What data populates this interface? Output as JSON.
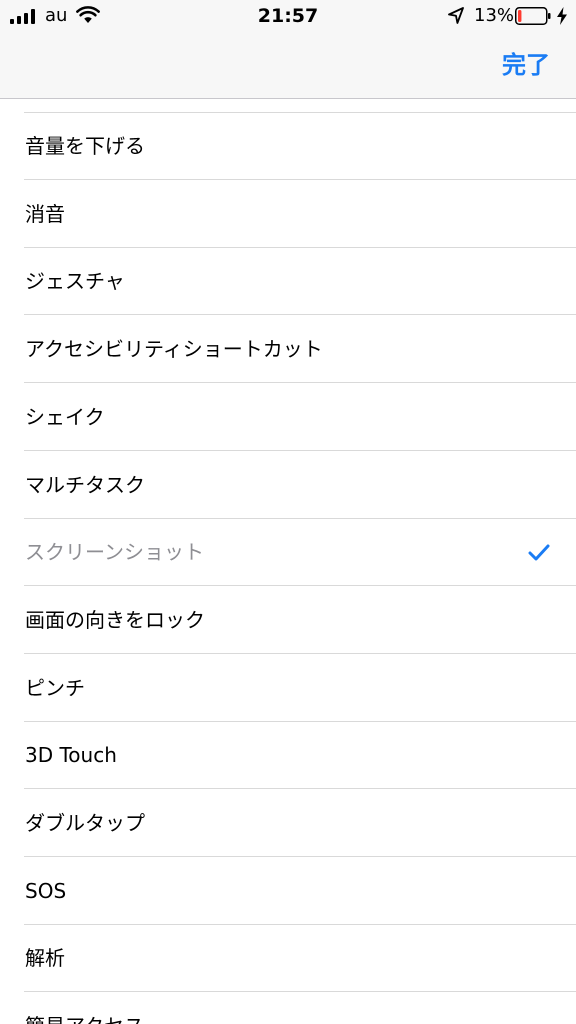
{
  "status_bar": {
    "carrier": "au",
    "time": "21:57",
    "battery_percent": "13%",
    "battery_level": 0.13,
    "battery_color": "#ff3b30",
    "icons": [
      "signal-icon",
      "wifi-icon",
      "location-icon",
      "battery-icon",
      "charging-bolt-icon"
    ]
  },
  "nav": {
    "done_label": "完了",
    "accent_color": "#1a7cf4"
  },
  "list": {
    "items": [
      {
        "label": "音量を下げる",
        "selected": false
      },
      {
        "label": "消音",
        "selected": false
      },
      {
        "label": "ジェスチャ",
        "selected": false
      },
      {
        "label": "アクセシビリティショートカット",
        "selected": false
      },
      {
        "label": "シェイク",
        "selected": false
      },
      {
        "label": "マルチタスク",
        "selected": false
      },
      {
        "label": "スクリーンショット",
        "selected": true
      },
      {
        "label": "画面の向きをロック",
        "selected": false
      },
      {
        "label": "ピンチ",
        "selected": false
      },
      {
        "label": "3D Touch",
        "selected": false
      },
      {
        "label": "ダブルタップ",
        "selected": false
      },
      {
        "label": "SOS",
        "selected": false
      },
      {
        "label": "解析",
        "selected": false
      },
      {
        "label": "簡易アクセス",
        "selected": false
      }
    ],
    "check_icon": "checkmark-icon"
  }
}
